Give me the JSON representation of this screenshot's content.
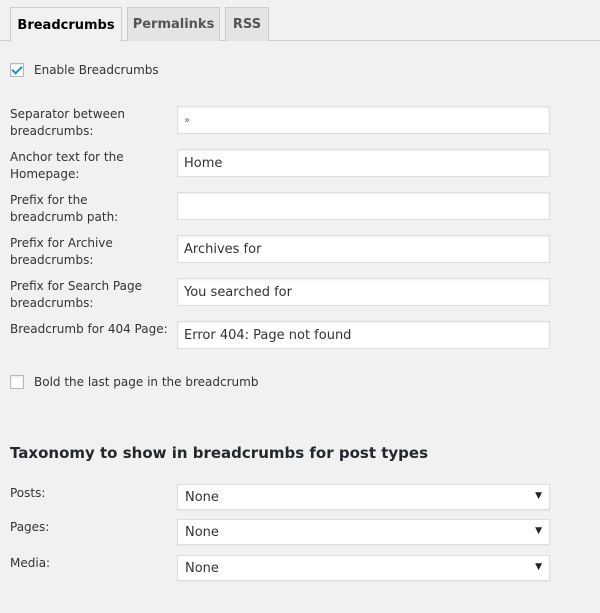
{
  "tabs": [
    {
      "label": "Breadcrumbs",
      "active": true
    },
    {
      "label": "Permalinks",
      "active": false
    },
    {
      "label": "RSS",
      "active": false
    }
  ],
  "enable": {
    "label": "Enable Breadcrumbs",
    "checked": true
  },
  "fields": {
    "separator": {
      "label": "Separator between breadcrumbs:",
      "value": "»"
    },
    "home": {
      "label": "Anchor text for the Homepage:",
      "value": "Home"
    },
    "prefix": {
      "label": "Prefix for the breadcrumb path:",
      "value": ""
    },
    "archive": {
      "label": "Prefix for Archive breadcrumbs:",
      "value": "Archives for"
    },
    "search": {
      "label": "Prefix for Search Page breadcrumbs:",
      "value": "You searched for"
    },
    "notfound": {
      "label": "Breadcrumb for 404 Page:",
      "value": "Error 404: Page not found"
    }
  },
  "bold_last": {
    "label": "Bold the last page in the breadcrumb",
    "checked": false
  },
  "taxonomy": {
    "heading": "Taxonomy to show in breadcrumbs for post types",
    "rows": {
      "posts": {
        "label": "Posts:",
        "value": "None"
      },
      "pages": {
        "label": "Pages:",
        "value": "None"
      },
      "media": {
        "label": "Media:",
        "value": "None"
      }
    }
  },
  "icons": {
    "checkmark": "checkmark-icon",
    "dropdown_arrow": "▼"
  }
}
